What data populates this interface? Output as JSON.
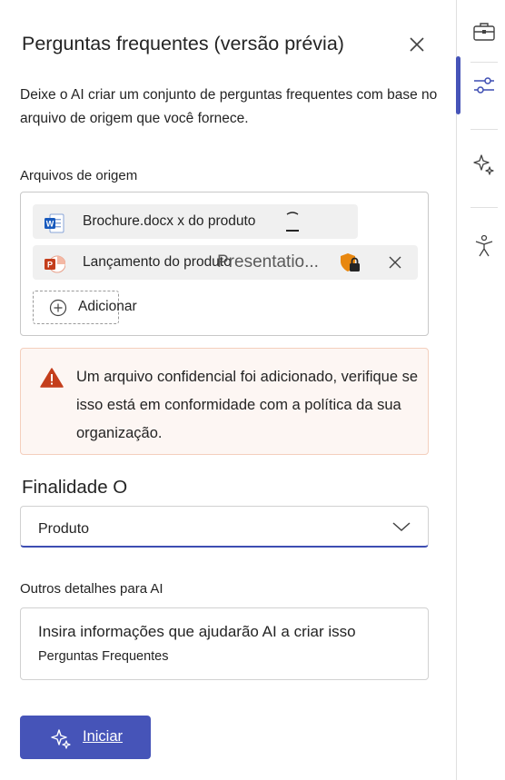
{
  "panel": {
    "title": "Perguntas frequentes (versão prévia)",
    "description": "Deixe o AI criar um conjunto de perguntas frequentes com base no arquivo de origem que você fornece."
  },
  "source_files": {
    "label": "Arquivos de origem",
    "files": [
      {
        "name": "Brochure.docx x do produto",
        "icon": "word-doc-icon"
      },
      {
        "name": "Lançamento do produto",
        "icon": "powerpoint-icon"
      }
    ],
    "overlay_text": "Presentatio...",
    "add_label": "Adicionar"
  },
  "warning": {
    "text": "Um arquivo confidencial foi adicionado, verifique se isso está em conformidade com a política da sua organização.",
    "color": "#c43e1c"
  },
  "purpose": {
    "label": "Finalidade O",
    "selected": "Produto"
  },
  "details": {
    "label": "Outros detalhes para AI",
    "placeholder": "Insira informações que ajudarão AI a criar isso",
    "value": "Perguntas Frequentes"
  },
  "start_button": {
    "label": "Iniciar"
  },
  "colors": {
    "accent": "#4654b8",
    "warning_bg": "#fdf6f3"
  },
  "rail": {
    "icons": [
      "briefcase-icon",
      "sliders-icon",
      "sparkle-icon",
      "accessibility-icon"
    ]
  }
}
